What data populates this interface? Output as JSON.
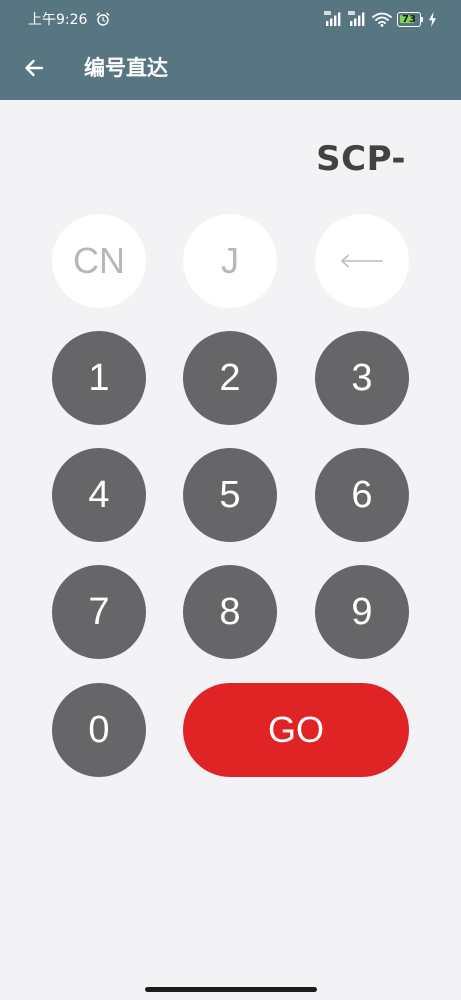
{
  "status_bar": {
    "time": "上午9:26",
    "icons": [
      "alarm-icon",
      "signal-icon",
      "signal-icon",
      "wifi-icon",
      "battery-icon",
      "charging-icon"
    ],
    "battery_level": "73"
  },
  "app_bar": {
    "back_icon": "arrow-left-icon",
    "title": "编号直达"
  },
  "display": {
    "value": "SCP-"
  },
  "keypad": {
    "cn_label": "CN",
    "j_label": "J",
    "backspace_icon": "backspace-arrow-icon",
    "digits": [
      "0",
      "1",
      "2",
      "3",
      "4",
      "5",
      "6",
      "7",
      "8",
      "9"
    ],
    "go_label": "GO"
  },
  "colors": {
    "app_bar": "#587682",
    "background": "#f3f2f5",
    "digit_key": "#666567",
    "go_button": "#e02426",
    "light_key": "#ffffff",
    "display_text": "#424242"
  }
}
